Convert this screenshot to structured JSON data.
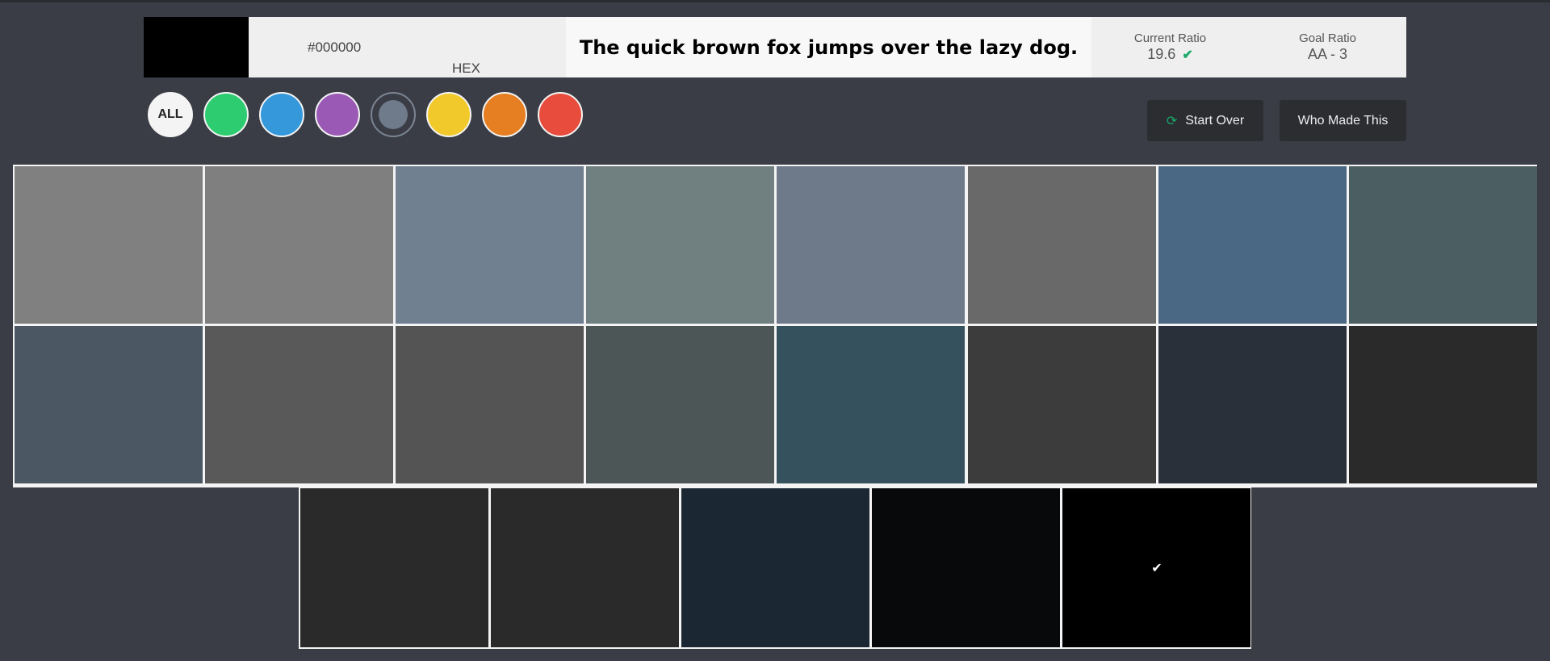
{
  "header": {
    "preview_color": "#000000",
    "hex_value": "#000000",
    "hex_label": "HEX",
    "sample_text": "The quick brown fox jumps over the lazy dog.",
    "current_ratio_label": "Current Ratio",
    "current_ratio_value": "19.6",
    "goal_ratio_label": "Goal Ratio",
    "goal_ratio_value": "AA - 3",
    "check_color": "#1aaa6a"
  },
  "filters": [
    {
      "name": "filter-all",
      "label": "ALL",
      "color": "#f4f4f4"
    },
    {
      "name": "filter-green",
      "label": "",
      "color": "#2ecc71"
    },
    {
      "name": "filter-blue",
      "label": "",
      "color": "#3498db"
    },
    {
      "name": "filter-purple",
      "label": "",
      "color": "#9b59b6"
    },
    {
      "name": "filter-gray",
      "label": "",
      "color": "#6f7a8a",
      "selected": true
    },
    {
      "name": "filter-yellow",
      "label": "",
      "color": "#f1c92a"
    },
    {
      "name": "filter-orange",
      "label": "",
      "color": "#e67e22"
    },
    {
      "name": "filter-red",
      "label": "",
      "color": "#e74c3c"
    }
  ],
  "buttons": {
    "start_over": "Start Over",
    "who_made_this": "Who Made This"
  },
  "swatches": [
    [
      "#808080",
      "#7f7f7f",
      "#708090",
      "#708080",
      "#6e7a8a",
      "#696969",
      "#4a6784",
      "#4b5f63"
    ],
    [
      "#4b5763",
      "#595959",
      "#545454",
      "#4d5656",
      "#34515d",
      "#3c3c3c",
      "#29303a",
      "#2a2a2a"
    ],
    [
      "#2a2a2a",
      "#2a2a2a",
      "#1b2733",
      "#08090b",
      "#000000"
    ]
  ],
  "selected_swatch": "#000000"
}
